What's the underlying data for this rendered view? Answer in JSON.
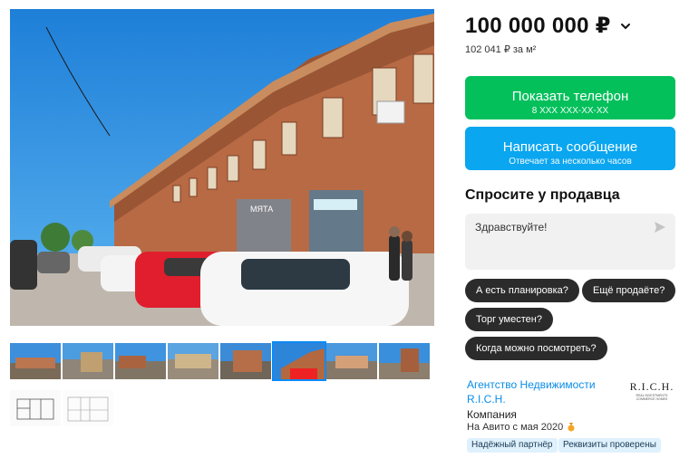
{
  "listing": {
    "price": "100 000 000 ₽",
    "price_per_m2": "102 041 ₽ за м²"
  },
  "actions": {
    "phone_label": "Показать телефон",
    "phone_masked": "8 XXX XXX-XX-XX",
    "message_label": "Написать сообщение",
    "message_sub": "Отвечает за несколько часов"
  },
  "ask": {
    "title": "Спросите у продавца",
    "input_value": "Здравствуйте!",
    "chips": [
      "А есть планировка?",
      "Ещё продаёте?",
      "Торг уместен?",
      "Когда можно посмотреть?"
    ]
  },
  "seller": {
    "name": "Агентство Недвижимости R.I.C.H.",
    "type": "Компания",
    "since": "На Авито с мая 2020",
    "badges": [
      "Надёжный партнёр",
      "Реквизиты проверены"
    ],
    "logo_text": "R.I.C.H.",
    "logo_subtext": "REAL INVESTMENTS COMMERCE HOMES"
  },
  "gallery": {
    "thumb_count": 10,
    "active_index": 5,
    "shop_sign": "МЯТА"
  },
  "colors": {
    "phone_button": "#04c05b",
    "message_button": "#0aa6f0",
    "chip": "#2b2b2b",
    "link": "#0a8ce8",
    "badge_bg": "#dff1fd"
  },
  "icons": [
    "chevron-down-icon",
    "send-icon",
    "medal-icon"
  ]
}
